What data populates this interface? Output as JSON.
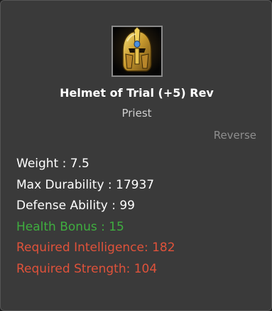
{
  "item": {
    "icon": "helmet-icon",
    "name": "Helmet of Trial (+5) Rev",
    "class": "Priest",
    "tag": "Reverse"
  },
  "stats": [
    {
      "text": "Weight : 7.5",
      "color": "#ffffff"
    },
    {
      "text": "Max Durability : 17937",
      "color": "#ffffff"
    },
    {
      "text": "Defense Ability : 99",
      "color": "#ffffff"
    },
    {
      "text": "Health Bonus : 15",
      "color": "#3fae3f"
    },
    {
      "text": "Required Intelligence: 182",
      "color": "#e0523a"
    },
    {
      "text": "Required Strength: 104",
      "color": "#e0523a"
    }
  ]
}
